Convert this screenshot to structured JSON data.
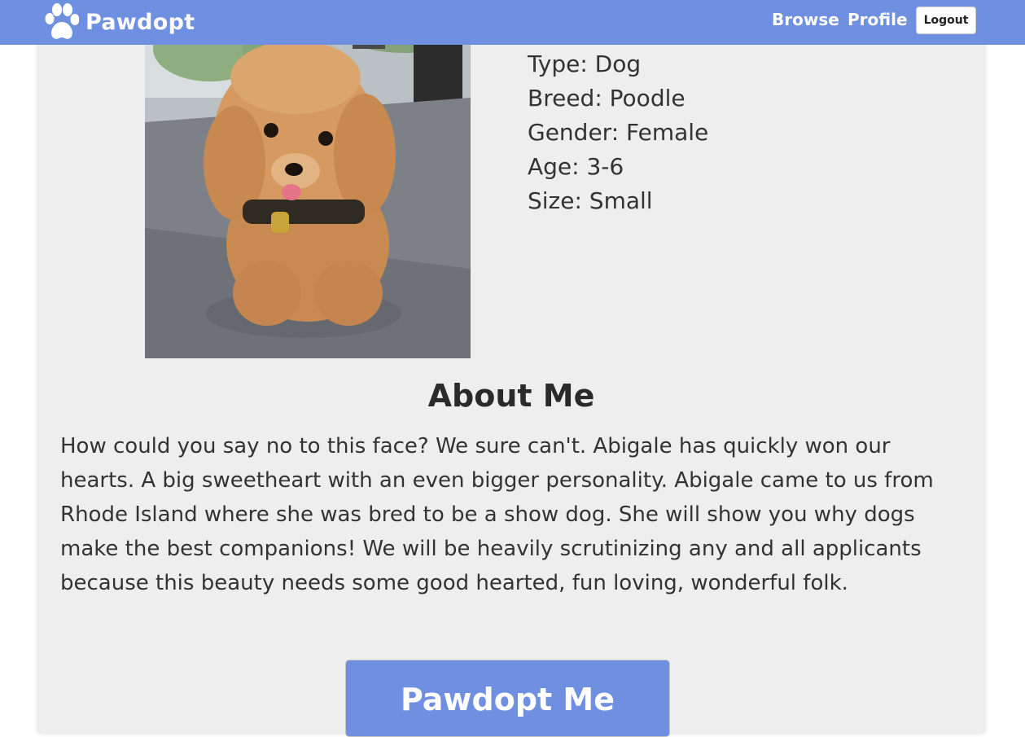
{
  "navbar": {
    "brand": "Pawdopt",
    "links": {
      "browse": "Browse",
      "profile": "Profile"
    },
    "logout_label": "Logout",
    "background_color": "#6f8fe0"
  },
  "pet": {
    "photo_icon": "poodle-photo",
    "details": [
      "Type: Dog",
      "Breed: Poodle",
      "Gender: Female",
      "Age: 3-6",
      "Size: Small"
    ]
  },
  "about": {
    "title": "About Me",
    "text": "How could you say no to this face? We sure can't. Abigale has quickly won our hearts. A big sweetheart with an even bigger personality. Abigale came to us from Rhode Island where she was bred to be a show dog. She will show you why dogs make the best companions! We will be heavily scrutinizing any and all applicants because this beauty needs some good hearted, fun loving, wonderful folk."
  },
  "cta": {
    "label": "Pawdopt Me"
  }
}
